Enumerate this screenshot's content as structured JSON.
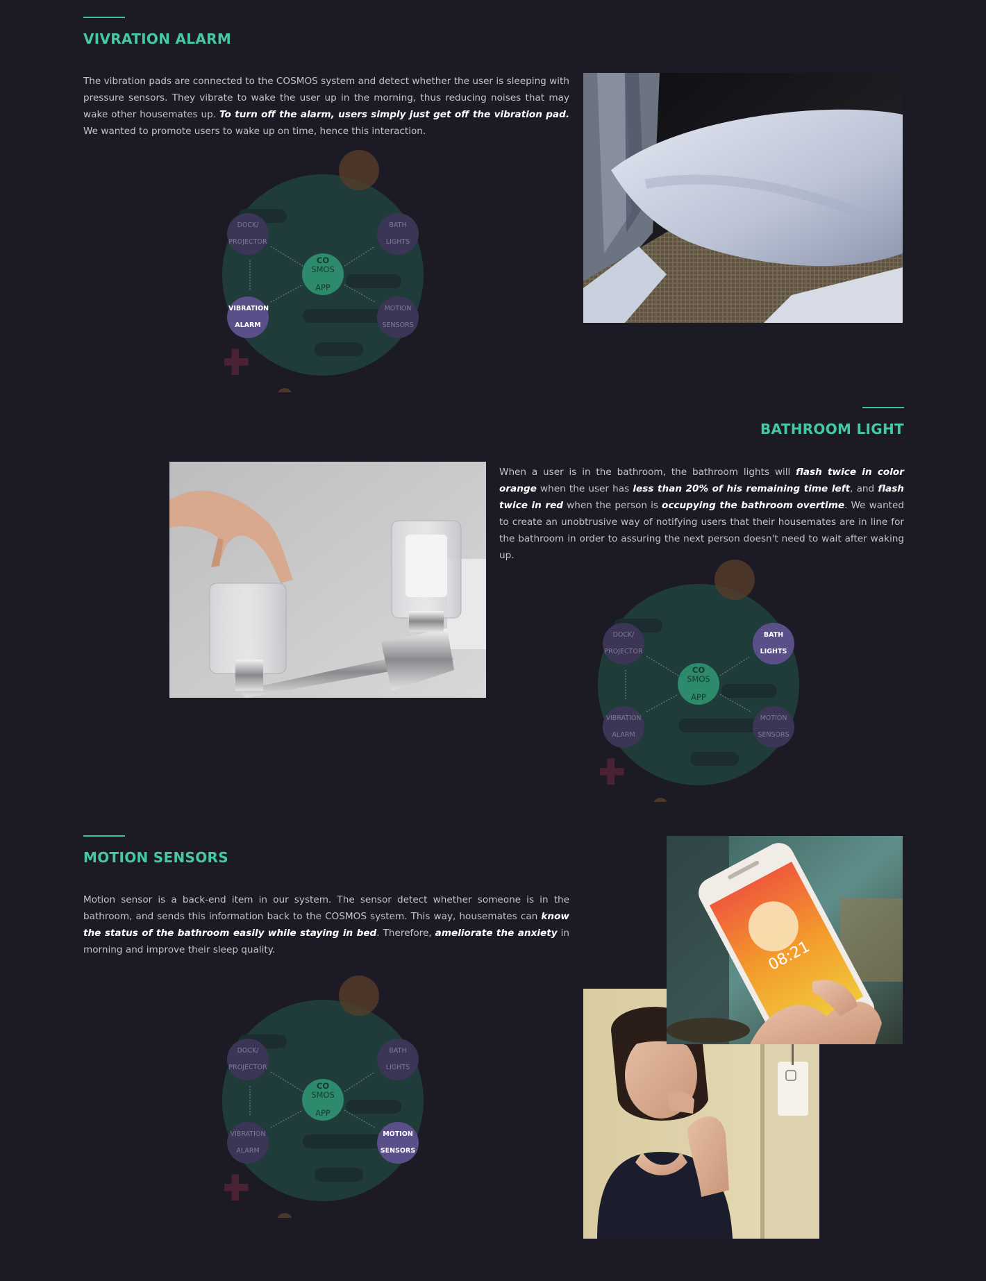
{
  "sections": {
    "vibration": {
      "heading": "VIVRATION ALARM",
      "p1": "The vibration pads are connected to the COSMOS system and detect whether the user is sleeping with pressure sensors. They vibrate to wake the user up in the morning, thus reducing noises that may wake other housemates up. ",
      "p1_strong": "To turn off the alarm, users simply just get off the vibration pad.",
      "p1_end": " We wanted to promote users to wake up on time, hence this interaction."
    },
    "bathroom": {
      "heading": "BATHROOM LIGHT",
      "t1": "When a user is in the bathroom, the bathroom lights will ",
      "s1": "flash twice in color orange",
      "t2": " when the user has ",
      "s2": "less than 20% of his remaining time left",
      "t3": ", and ",
      "s3": "flash twice in red",
      "t4": " when the person is ",
      "s4": "occupying the bathroom overtime",
      "t5": ". We wanted to create an unobtrusive way of notifying users that their housemates are in line for the bathroom in order to assuring the next person doesn't need to wait after waking up."
    },
    "motion": {
      "heading": "MOTION SENSORS",
      "t1": "Motion sensor is a back-end item in our system. The sensor detect whether someone is in the bathroom, and sends this information back to the COSMOS system. This way, housemates can ",
      "s1": "know the status of the bathroom easily while staying in bed",
      "t2": ". Therefore, ",
      "s2": "ameliorate the anxiety",
      "t3": " in morning and improve their sleep quality."
    }
  },
  "diagram": {
    "hub_co": "CO",
    "hub_smos": "SMOS",
    "hub_app": "APP",
    "dock_l1": "DOCK/",
    "dock_l2": "PROJECTOR",
    "bath_l1": "BATH",
    "bath_l2": "LIGHTS",
    "vib_l1": "VIBRATION",
    "vib_l2": "ALARM",
    "motion_l1": "MOTION",
    "motion_l2": "SENSORS"
  },
  "photo_screen": {
    "time": "08:21"
  },
  "colors": {
    "background": "#1c1a25",
    "accent": "#45c9a0",
    "node": "#3b3656",
    "node_active": "#5b4f8a",
    "hub": "#2e8a6c"
  }
}
